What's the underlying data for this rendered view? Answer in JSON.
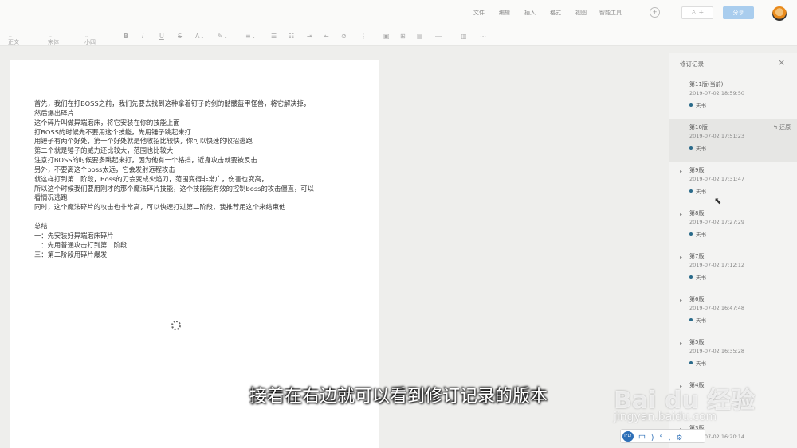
{
  "menu": [
    "文件",
    "编辑",
    "插入",
    "格式",
    "视图",
    "智能工具"
  ],
  "header": {
    "share_label": "分享",
    "add_label": "+"
  },
  "toolbar": {
    "style": "正文",
    "font": "宋体",
    "size": "小四"
  },
  "document": {
    "lines": [
      "首先，我们在打BOSS之前，我们先要去找到这种拿着钉子的剑的骷髅盔甲怪兽，将它解决掉，",
      "然后爆出碎片",
      "这个碎片叫做异端磨床，将它安装在你的技能上面",
      "打BOSS的时候先不要用这个技能，先用锤子跳起来打",
      "用锤子有两个好处，第一个好处就是他收招比较快，你可以快速的收招逃跑",
      "第二个就是锤子的威力还比较大，范围也比较大",
      "注意打BOSS的时候要多跳起来打，因为他有一个格挡，近身攻击就要被反击",
      "另外，不要离这个boss太远，它会发射远程攻击",
      "就这样打到第二阶段，Boss的刀会变成火焰刀，范围变得非常广，伤害也变高，",
      "所以这个时候我们要用刚才的那个魔法碎片技能，这个技能能有效的控制boss的攻击僵直，可以",
      "看情况逃跑",
      "同时，这个魔法碎片的攻击也非常高，可以快速打过第二阶段，我推荐用这个来结束他",
      "",
      "总结",
      "一：先安装好异端磨床碎片",
      "二：先用普通攻击打到第二阶段",
      "三：第二阶段用碎片爆发"
    ]
  },
  "revisions": {
    "title": "修订记录",
    "restore_label": "还原",
    "versions": [
      {
        "name": "第11版(当前)",
        "time": "2019-07-02 18:59:50",
        "author": "天书"
      },
      {
        "name": "第10版",
        "time": "2019-07-02 17:51:23",
        "author": "天书"
      },
      {
        "name": "第9版",
        "time": "2019-07-02 17:31:47",
        "author": "天书"
      },
      {
        "name": "第8版",
        "time": "2019-07-02 17:27:29",
        "author": "天书"
      },
      {
        "name": "第7版",
        "time": "2019-07-02 17:12:12",
        "author": "天书"
      },
      {
        "name": "第6版",
        "time": "2019-07-02 16:47:48",
        "author": "天书"
      },
      {
        "name": "第5版",
        "time": "2019-07-02 16:35:28",
        "author": "天书"
      },
      {
        "name": "第4版",
        "time": "",
        "author": ""
      },
      {
        "name": "第3版",
        "time": "2019-07-02 16:20:14",
        "author": ""
      }
    ]
  },
  "subtitle": "接着在右边就可以看到修订记录的版本",
  "watermark": {
    "brand": "Bai du 经验",
    "url": "jingyan.baidu.com"
  },
  "ime": {
    "text": "中 ) ° ,  ⚙"
  },
  "colors": {
    "share_button": "#a9cdee",
    "author_dot": "#2a6a8a",
    "background": "#eeeeec"
  }
}
